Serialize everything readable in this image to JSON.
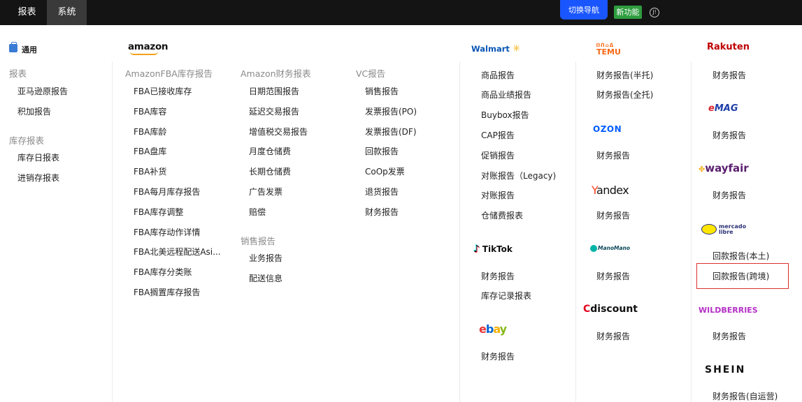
{
  "topbar": {
    "tabs": [
      "报表",
      "系统"
    ],
    "switch_nav": "切换导航",
    "new_feature": "新功能",
    "help_glyph": "J!"
  },
  "general": {
    "label": "通用",
    "sec1": "报表",
    "sec1_items": [
      "亚马逊原报告",
      "积加报告"
    ],
    "sec2": "库存报表",
    "sec2_items": [
      "库存日报表",
      "进销存报表"
    ]
  },
  "amazon": {
    "logo": "amazon",
    "fba_title": "AmazonFBA库存报告",
    "fba_items": [
      "FBA已接收库存",
      "FBA库容",
      "FBA库龄",
      "FBA盘库",
      "FBA补货",
      "FBA每月库存报告",
      "FBA库存调整",
      "FBA库存动作详情",
      "FBA北美远程配送Asi...",
      "FBA库存分类账",
      "FBA搁置库存报告"
    ],
    "fin_title": "Amazon财务报表",
    "fin_items": [
      "日期范围报告",
      "延迟交易报告",
      "增值税交易报告",
      "月度仓储费",
      "长期仓储费",
      "广告发票",
      "赔偿"
    ],
    "sales_title": "销售报告",
    "sales_items": [
      "业务报告",
      "配送信息"
    ],
    "vc_title": "VC报告",
    "vc_items": [
      "销售报告",
      "发票报告(PO)",
      "发票报告(DF)",
      "回款报告",
      "CoOp发票",
      "退货报告",
      "财务报告"
    ]
  },
  "walmart": {
    "logo": "Walmart",
    "items": [
      "商品报告",
      "商品业绩报告",
      "Buybox报告",
      "CAP报告",
      "促销报告",
      "对账报告（Legacy)",
      "对账报告",
      "仓储费报表"
    ]
  },
  "tiktok": {
    "logo": "TikTok",
    "items": [
      "财务报告",
      "库存记录报表"
    ]
  },
  "ebay": {
    "logo": "ebay",
    "items": [
      "财务报告"
    ]
  },
  "temu": {
    "logo_top": "ᗷᑎ⌂ᐃ",
    "logo": "TEMU",
    "items": [
      "财务报告(半托)",
      "财务报告(全托)"
    ]
  },
  "ozon": {
    "logo": "OZON",
    "items": [
      "财务报告"
    ]
  },
  "yandex": {
    "logo_first": "Y",
    "logo_rest": "andex",
    "items": [
      "财务报告"
    ]
  },
  "manomano": {
    "logo": "ManoMano",
    "items": [
      "财务报告"
    ]
  },
  "cdiscount": {
    "logo_first": "C",
    "logo_rest": "discount",
    "items": [
      "财务报告"
    ]
  },
  "rakuten": {
    "logo": "Rakuten",
    "items": [
      "财务报告"
    ]
  },
  "emag": {
    "logo_first": "e",
    "logo_rest": "MAG",
    "items": [
      "财务报告"
    ]
  },
  "wayfair": {
    "logo": "wayfair",
    "items": [
      "财务报告"
    ]
  },
  "mercado": {
    "logo_line1": "mercado",
    "logo_line2": "libre",
    "items": [
      "回款报告(本土)",
      "回款报告(跨境)"
    ]
  },
  "wildberries": {
    "logo": "WILDBERRIES",
    "items": [
      "财务报告"
    ]
  },
  "shein": {
    "logo": "SHEIN",
    "items": [
      "财务报告(自运营)"
    ]
  },
  "colors": {
    "topbar": "#141414",
    "accent": "#1a56ff",
    "new_badge": "#2e9d3f",
    "highlight_border": "#d9302c"
  }
}
